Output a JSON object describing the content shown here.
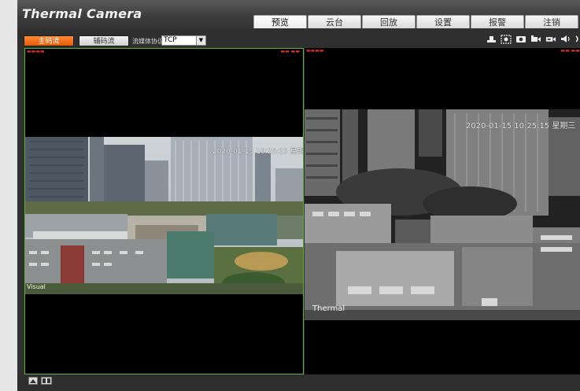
{
  "header": {
    "logo": "Thermal Camera",
    "tabs": [
      {
        "label": "预览",
        "active": true
      },
      {
        "label": "云台"
      },
      {
        "label": "回放"
      },
      {
        "label": "设置"
      },
      {
        "label": "报警"
      },
      {
        "label": "注销"
      }
    ]
  },
  "toolbar": {
    "main_stream_label": "主码流",
    "sub_stream_label": "辅码流",
    "protocol_label": "流媒体协议",
    "protocol_value": "TCP",
    "icons": [
      "capture-icon",
      "zoom-icon",
      "snapshot-icon",
      "record-icon",
      "video-record-icon",
      "audio-icon",
      "more-icon"
    ]
  },
  "panes": {
    "left": {
      "timestamp": "2020-01-15 10:25:15 星期三",
      "channel_name": "Visual",
      "selected": true
    },
    "right": {
      "timestamp": "2020-01-15 10:25:15 星期三",
      "channel_name": "Thermal"
    }
  },
  "colors": {
    "accent": "#f07020",
    "selection_border": "#5fb13a",
    "header_bg": "#3b3b3b",
    "overlay_info": "#e23030"
  }
}
